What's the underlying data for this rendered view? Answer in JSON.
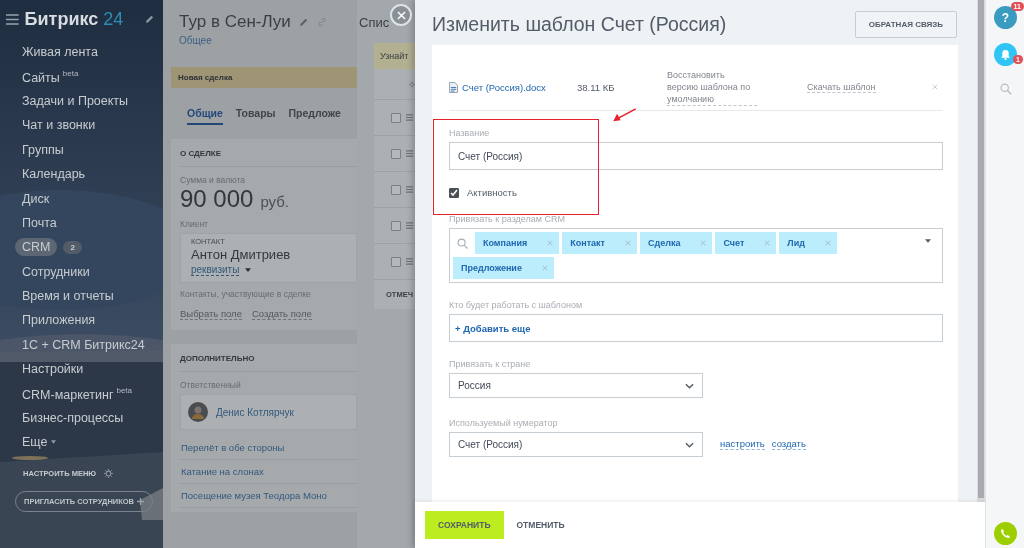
{
  "sidebar": {
    "logo": {
      "name": "Битрикс",
      "number": "24"
    },
    "items": [
      {
        "label": "Живая лента",
        "kind": "link",
        "selected": false
      },
      {
        "label": "Сайты",
        "sup": "beta",
        "kind": "link",
        "selected": false
      },
      {
        "label": "Задачи и Проекты",
        "kind": "link",
        "selected": false
      },
      {
        "label": "Чат и звонки",
        "kind": "link",
        "selected": false
      },
      {
        "label": "Группы",
        "kind": "link",
        "selected": false
      },
      {
        "label": "Календарь",
        "kind": "link",
        "selected": false
      },
      {
        "label": "Диск",
        "kind": "link",
        "selected": false
      },
      {
        "label": "Почта",
        "kind": "link",
        "selected": false
      },
      {
        "label": "CRM",
        "counter": "2",
        "kind": "link",
        "selected": true
      },
      {
        "label": "Сотрудники",
        "kind": "link",
        "selected": false
      },
      {
        "label": "Время и отчеты",
        "kind": "link",
        "selected": false
      },
      {
        "label": "Приложения",
        "kind": "link",
        "selected": false
      },
      {
        "label": "1С + CRM Битрикс24",
        "kind": "link",
        "selected": false
      },
      {
        "label": "Настройки",
        "kind": "link",
        "selected": false
      },
      {
        "label": "CRM-маркетинг",
        "sup": "beta",
        "kind": "link",
        "selected": false
      },
      {
        "label": "Бизнес-процессы",
        "kind": "link",
        "selected": false
      },
      {
        "label": "Еще",
        "kind": "dropdown",
        "selected": false
      }
    ],
    "settings_label": "НАСТРОИТЬ МЕНЮ",
    "invite_button": "ПРИГЛАСИТЬ СОТРУДНИКОВ"
  },
  "deal": {
    "title": "Тур в Сен-Луи",
    "subtitle": "Общее",
    "stage": "Новая сделка",
    "tabs": [
      {
        "label": "Общие",
        "selected": true
      },
      {
        "label": "Товары",
        "selected": false
      },
      {
        "label": "Предложе",
        "selected": false
      }
    ],
    "about": {
      "heading": "О СДЕЛКЕ",
      "amount_label": "Сумма и валюта",
      "amount": "90 000",
      "currency": "руб.",
      "client_label": "Клиент",
      "contact_caption": "КОНТАКТ",
      "contact_name": "Антон Дмитриев",
      "requisites": "реквизиты",
      "contacts_note": "Контакты, участвующие в сделке",
      "links": [
        "Выбрать поле",
        "Создать поле"
      ]
    },
    "extra": {
      "heading": "ДОПОЛНИТЕЛЬНО",
      "responsible_label": "Ответственный",
      "responsible_name": "Денис Котлярчук",
      "products": [
        "Перелёт в обе стороны",
        "Катание на слонах",
        "Посещение музея Теодора Моно"
      ]
    }
  },
  "list_panel": {
    "title": "Спис",
    "notice": "Узнайт",
    "rows": [
      {
        "checked": false
      },
      {
        "checked": false
      },
      {
        "checked": false
      },
      {
        "checked": false
      },
      {
        "checked": false
      }
    ],
    "footer": "ОТМЕЧ"
  },
  "editor": {
    "title": "Изменить шаблон Счет (Россия)",
    "feedback_button": "ОБРАТНАЯ СВЯЗЬ",
    "file": {
      "name": "Счет (Россия).docx",
      "size": "38.11 КБ",
      "restore": "Восстановить версию шаблона по умолчанию",
      "download": "Скачать шаблон"
    },
    "name_field": {
      "label": "Название",
      "value": "Счет (Россия)"
    },
    "active": {
      "label": "Активность",
      "checked": true
    },
    "crm_sections": {
      "label": "Привязать к разделам CRM",
      "tags": [
        "Компания",
        "Контакт",
        "Сделка",
        "Счет",
        "Лид",
        "Предложение"
      ]
    },
    "users": {
      "label": "Кто будет работать с шаблоном",
      "add": "+ Добавить еще"
    },
    "country": {
      "label": "Привязать к стране",
      "value": "Россия"
    },
    "numerator": {
      "label": "Используемый нумератор",
      "value": "Счет (Россия)",
      "links": [
        "настроить",
        "создать"
      ]
    },
    "save_button": "СОХРАНИТЬ",
    "cancel_button": "ОТМЕНИТЬ"
  },
  "right_bar": {
    "help_label": "?",
    "help_badge": "11",
    "notifications_badge": "1"
  }
}
